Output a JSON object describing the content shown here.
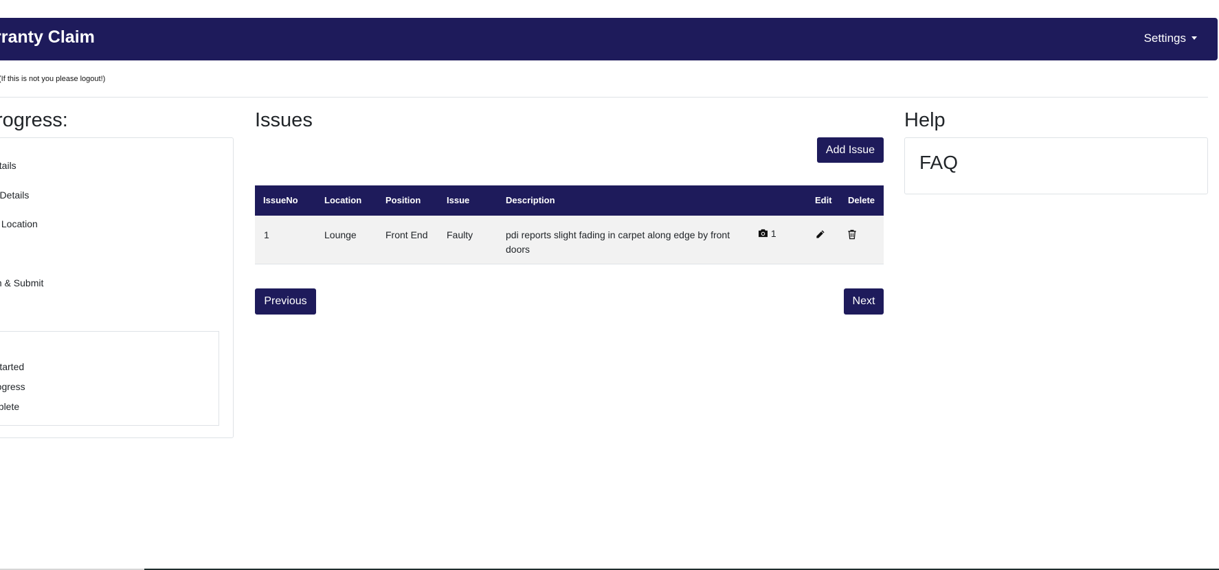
{
  "navbar": {
    "brand": "rranty Claim",
    "settings_label": "Settings"
  },
  "logout_note": "(If this is not you please logout!)",
  "progress": {
    "title": "rogress:",
    "steps": [
      "etails",
      "r Details",
      "s Location",
      "m & Submit"
    ],
    "legend": [
      "Started",
      "rogress",
      "nplete"
    ]
  },
  "issues": {
    "title": "Issues",
    "add_button": "Add Issue",
    "columns": {
      "issue_no": "IssueNo",
      "location": "Location",
      "position": "Position",
      "issue": "Issue",
      "description": "Description",
      "edit": "Edit",
      "delete": "Delete"
    },
    "rows": [
      {
        "issue_no": "1",
        "location": "Lounge",
        "position": "Front End",
        "issue": "Faulty",
        "description": "pdi reports slight fading in carpet along edge by front doors",
        "photo_count": "1",
        "photo_icon": "camera-icon",
        "edit_icon": "pencil-icon",
        "delete_icon": "trash-icon"
      }
    ],
    "previous_button": "Previous",
    "next_button": "Next"
  },
  "help": {
    "title": "Help",
    "faq": "FAQ"
  },
  "colors": {
    "brand_navy": "#1e1b5b",
    "row_background": "#f2f2f2",
    "border": "#dee2e6"
  }
}
